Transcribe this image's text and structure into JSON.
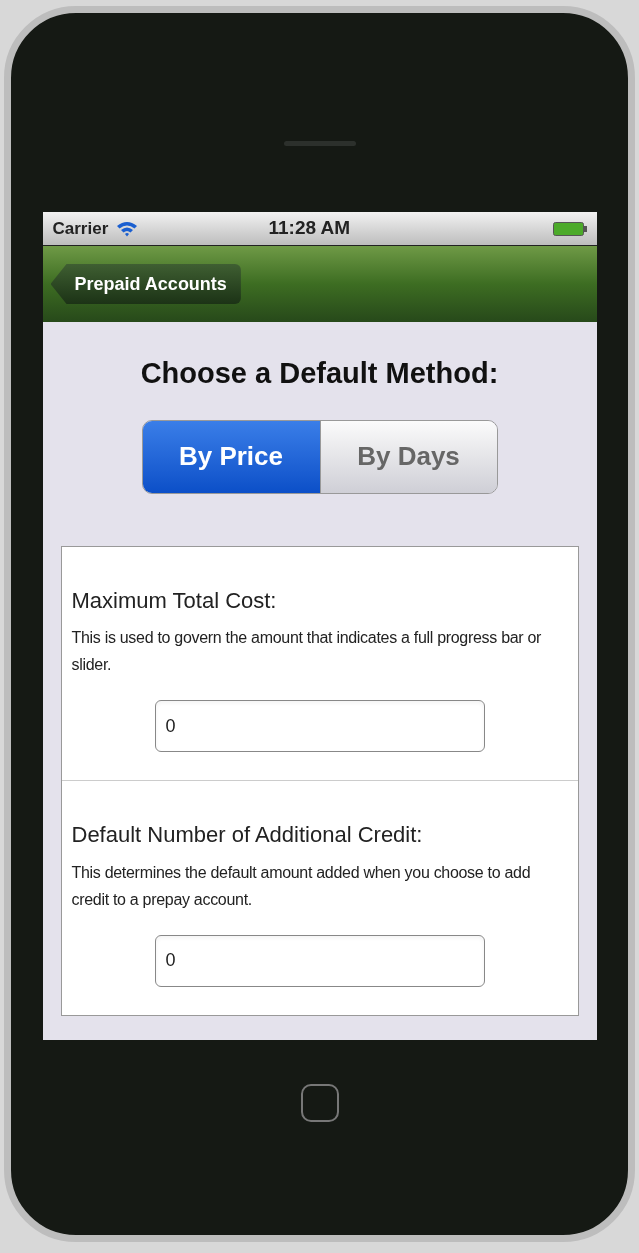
{
  "status_bar": {
    "carrier": "Carrier",
    "time": "11:28 AM"
  },
  "nav_bar": {
    "back_button": "Prepaid Accounts"
  },
  "heading": "Choose a Default Method:",
  "segments": [
    {
      "label": "By Price",
      "selected": true
    },
    {
      "label": "By Days",
      "selected": false
    }
  ],
  "fields": [
    {
      "label": "Maximum Total Cost:",
      "description": "This is used to govern the amount that indicates a full progress bar or slider.",
      "value": "0"
    },
    {
      "label": "Default Number of Additional Credit:",
      "description": "This determines the default amount added when you choose to add credit to a prepay account.",
      "value": "0"
    }
  ]
}
